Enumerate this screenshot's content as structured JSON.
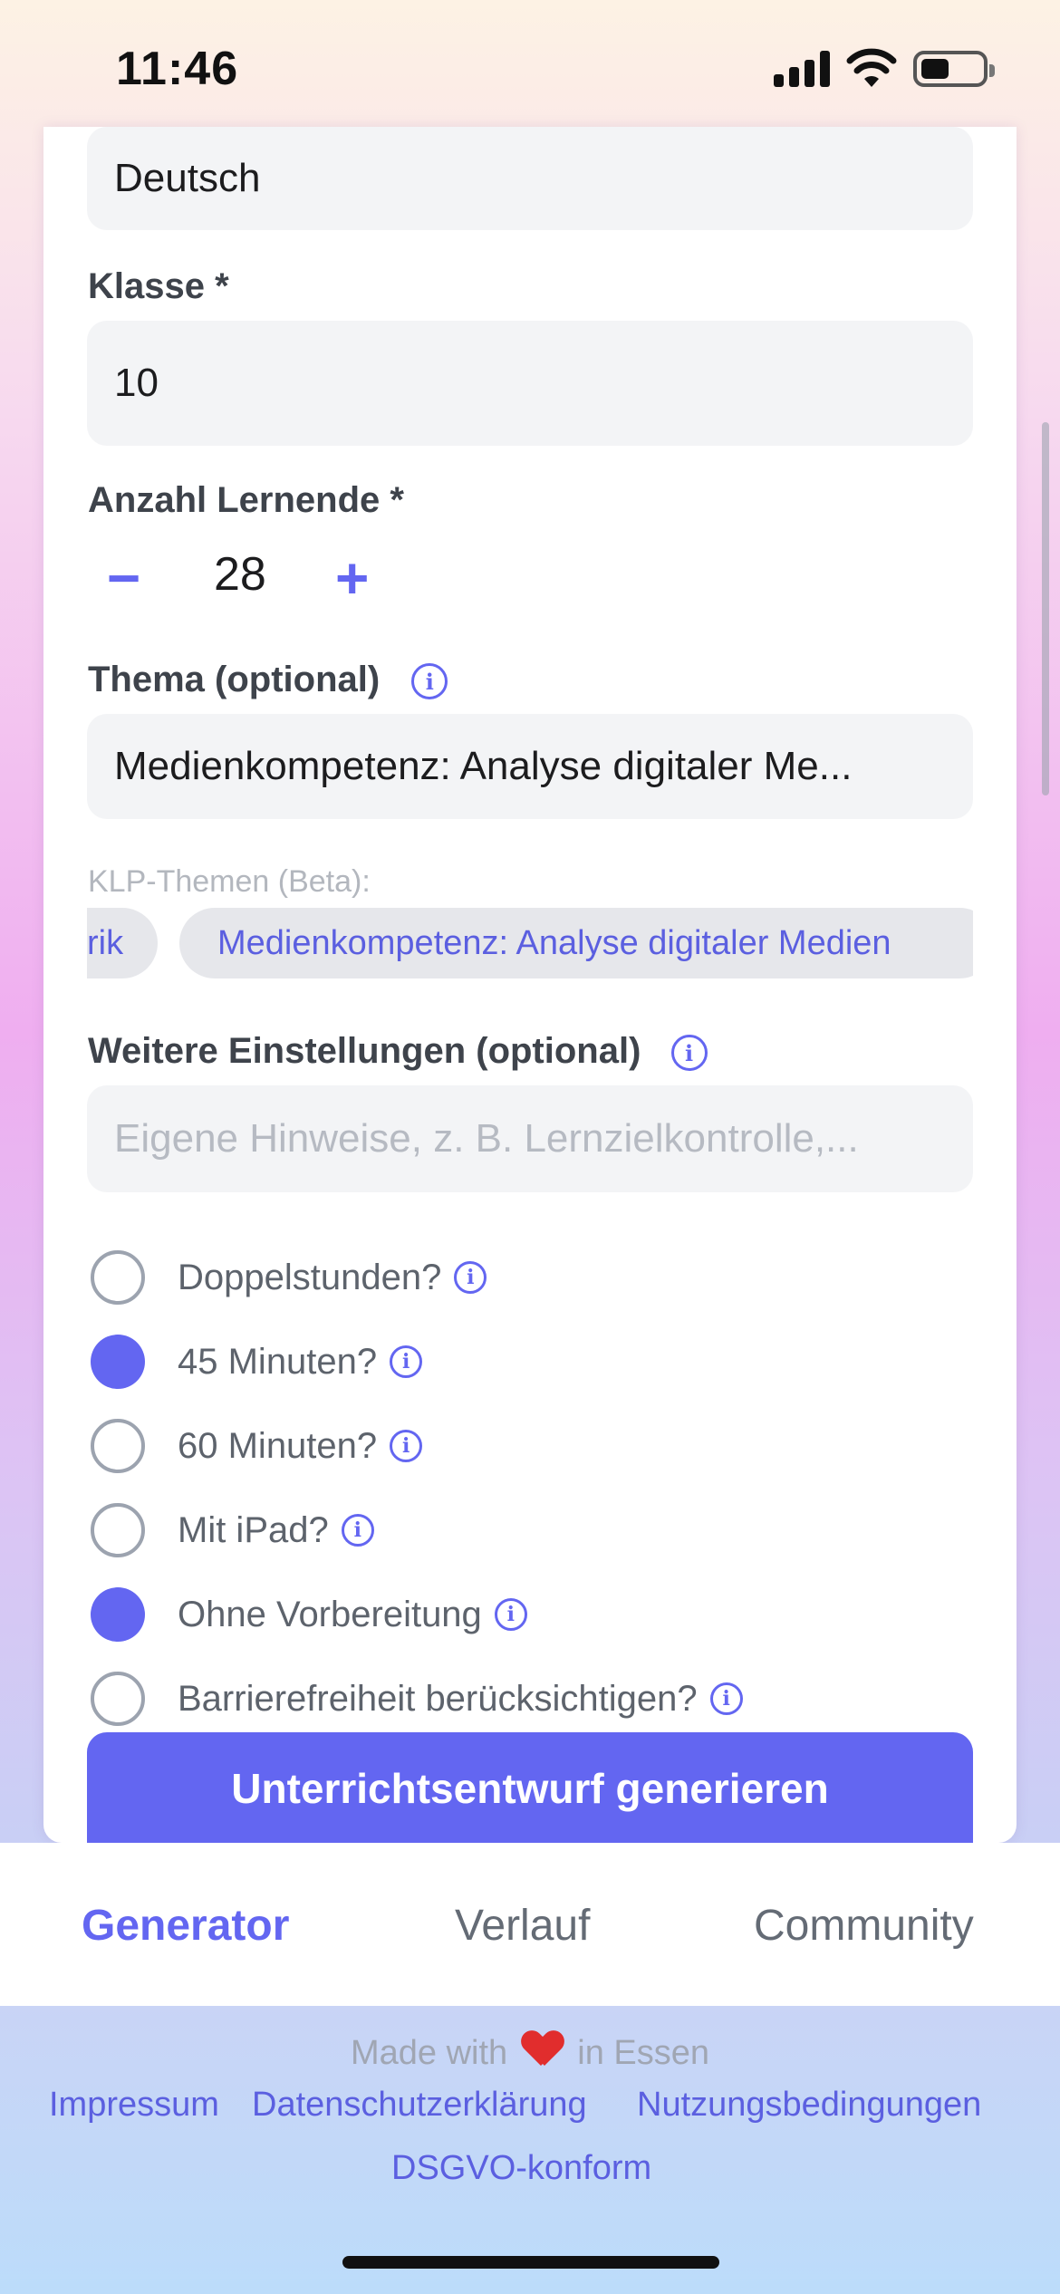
{
  "status_bar": {
    "time": "11:46"
  },
  "form": {
    "subject_value": "Deutsch",
    "grade_label": "Klasse *",
    "grade_value": "10",
    "students_label": "Anzahl Lernende *",
    "students_value": "28",
    "students_minus": "−",
    "students_plus": "+",
    "topic_label": "Thema (optional)",
    "topic_value": "Medienkompetenz: Analyse digitaler Me...",
    "klp_label": "KLP-Themen (Beta):",
    "klp_chips": [
      "rik",
      "Medienkompetenz: Analyse digitaler Medien"
    ],
    "settings_label": "Weitere Einstellungen (optional)",
    "settings_placeholder": "Eigene Hinweise, z. B. Lernzielkontrolle,...",
    "options": [
      {
        "label": "Doppelstunden?",
        "selected": false
      },
      {
        "label": "45 Minuten?",
        "selected": true
      },
      {
        "label": "60 Minuten?",
        "selected": false
      },
      {
        "label": "Mit iPad?",
        "selected": false
      },
      {
        "label": "Ohne Vorbereitung",
        "selected": true
      },
      {
        "label": "Barrierefreiheit berücksichtigen?",
        "selected": false
      }
    ],
    "generate_button": "Unterrichtsentwurf generieren",
    "info_glyph": "i"
  },
  "tabs": [
    "Generator",
    "Verlauf",
    "Community"
  ],
  "active_tab": "Generator",
  "footer": {
    "made_prefix": "Made with",
    "made_suffix": "in Essen",
    "links": [
      "Impressum",
      "Datenschutzerklärung",
      "Nutzungsbedingungen",
      "DSGVO-konform"
    ]
  },
  "colors": {
    "accent": "#6366f1",
    "heart": "#e12d2d"
  }
}
